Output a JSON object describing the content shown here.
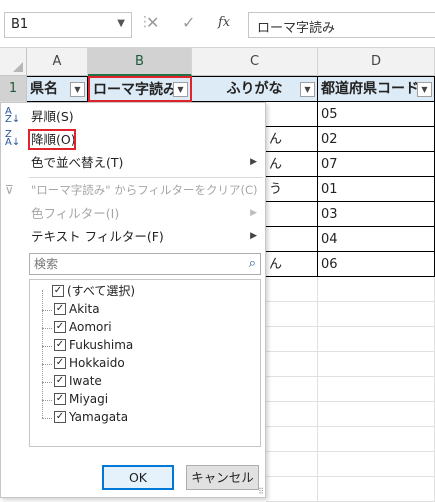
{
  "formula_bar": {
    "name_box": "B1",
    "formula": "ローマ字読み",
    "fx_label": "fx"
  },
  "sheet": {
    "columns": [
      "A",
      "B",
      "C",
      "D"
    ],
    "rows": [
      "1"
    ],
    "header_row": [
      "県名",
      "ローマ字読み",
      "ふりがな",
      "都道府県コード"
    ],
    "visible_partial_cells_c": [
      "ん",
      "ん",
      "う",
      "ん"
    ],
    "codes": [
      "05",
      "02",
      "07",
      "01",
      "03",
      "04",
      "06"
    ]
  },
  "menu": {
    "sort_asc": "昇順(S)",
    "sort_desc": "降順(O)",
    "sort_by_color": "色で並べ替え(T)",
    "clear_filter": "\"ローマ字読み\" からフィルターをクリア(C)",
    "color_filter": "色フィルター(I)",
    "text_filter": "テキスト フィルター(F)",
    "search_placeholder": "検索",
    "items": [
      "(すべて選択)",
      "Akita",
      "Aomori",
      "Fukushima",
      "Hokkaido",
      "Iwate",
      "Miyagi",
      "Yamagata"
    ],
    "ok": "OK",
    "cancel": "キャンセル"
  },
  "colors": {
    "accent_green": "#217346",
    "highlight_red": "#e0242e",
    "header_fill": "#ddebf7",
    "ok_border": "#0078d7"
  }
}
